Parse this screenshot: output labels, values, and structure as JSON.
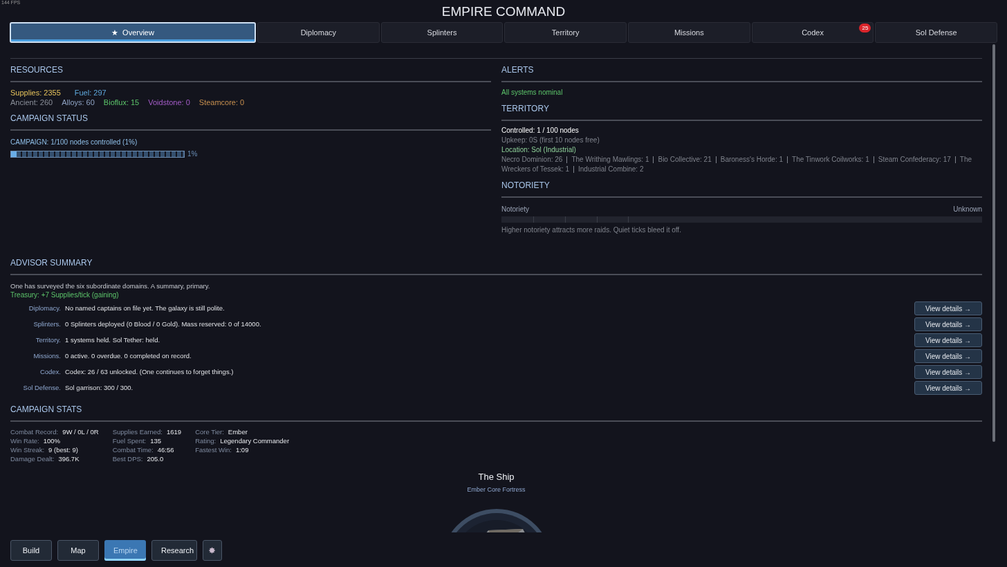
{
  "fps": "144 FPS",
  "title": "EMPIRE COMMAND",
  "tabs": [
    {
      "label": "Overview",
      "icon": "★",
      "selected": true
    },
    {
      "label": "Diplomacy",
      "selected": false
    },
    {
      "label": "Splinters",
      "selected": false
    },
    {
      "label": "Territory",
      "selected": false
    },
    {
      "label": "Missions",
      "selected": false
    },
    {
      "label": "Codex",
      "badge": "25",
      "selected": false
    },
    {
      "label": "Sol Defense",
      "selected": false
    }
  ],
  "resources": {
    "heading": "RESOURCES",
    "rows": [
      [
        {
          "text": "Supplies: 2355",
          "color": "#e6c35c"
        },
        {
          "text": "Fuel: 297",
          "color": "#5fa8dc"
        }
      ],
      [
        {
          "text": "Ancient: 260",
          "color": "#8a8f99"
        },
        {
          "text": "Alloys: 60",
          "color": "#8fa3c4"
        },
        {
          "text": "Bioflux: 15",
          "color": "#5cc46a"
        },
        {
          "text": "Voidstone: 0",
          "color": "#a45cc8"
        },
        {
          "text": "Steamcore: 0",
          "color": "#c8904f"
        }
      ]
    ]
  },
  "campaign_status": {
    "heading": "CAMPAIGN STATUS",
    "label": "CAMPAIGN: 1/100 nodes controlled (1%)",
    "level": 0.01,
    "reading": "1%"
  },
  "alerts": {
    "heading": "ALERTS",
    "message": "All systems nominal"
  },
  "territory": {
    "heading": "TERRITORY",
    "controlled": "Controlled: 1 / 100 nodes",
    "upkeep": "Upkeep: 0S (first 10 nodes free)",
    "location": "Location: Sol (Industrial)",
    "factions": [
      "Necro Dominion: 26",
      "The Writhing Mawlings: 1",
      "Bio Collective: 21",
      "Baroness's Horde: 1",
      "The Tinwork Coilworks: 1",
      "Steam Confederacy: 17",
      "The Wreckers of Tessek: 1",
      "Industrial Combine: 2"
    ]
  },
  "notoriety": {
    "heading": "NOTORIETY",
    "label": "Notoriety",
    "reading": "Unknown",
    "hint": "Higher notoriety attracts more raids. Quiet ticks bleed it off."
  },
  "advisor": {
    "heading": "ADVISOR SUMMARY",
    "intro": "One has surveyed the six subordinate domains. A summary, primary.",
    "treasury": "Treasury: +7 Supplies/tick (gaining)",
    "entries": [
      {
        "domain": "Diplomacy.",
        "summary": "No named captains on file yet. The galaxy is still polite.",
        "button": "View details →"
      },
      {
        "domain": "Splinters.",
        "summary": "0 Splinters deployed (0 Blood / 0 Gold). Mass reserved: 0 of 14000.",
        "button": "View details →"
      },
      {
        "domain": "Territory.",
        "summary": "1 systems held. Sol Tether: held.",
        "button": "View details →"
      },
      {
        "domain": "Missions.",
        "summary": "0 active. 0 overdue. 0 completed on record.",
        "button": "View details →"
      },
      {
        "domain": "Codex.",
        "summary": "Codex: 26 / 63 unlocked. (One continues to forget things.)",
        "button": "View details →"
      },
      {
        "domain": "Sol Defense.",
        "summary": "Sol garrison: 300 / 300.",
        "button": "View details →"
      }
    ]
  },
  "campaign_stats": {
    "heading": "CAMPAIGN STATS",
    "columns": [
      [
        {
          "label": "Combat Record:",
          "value": "9W / 0L / 0R"
        },
        {
          "label": "Win Rate:",
          "value": "100%"
        },
        {
          "label": "Win Streak:",
          "value": "9 (best: 9)"
        },
        {
          "label": "Damage Dealt:",
          "value": "396.7K"
        }
      ],
      [
        {
          "label": "Supplies Earned:",
          "value": "1619"
        },
        {
          "label": "Fuel Spent:",
          "value": "135"
        },
        {
          "label": "Combat Time:",
          "value": "46:56"
        },
        {
          "label": "Best DPS:",
          "value": "205.0"
        }
      ],
      [
        {
          "label": "Core Tier:",
          "value": "Ember"
        },
        {
          "label": "Rating:",
          "value": "Legendary Commander"
        },
        {
          "label": "Fastest Win:",
          "value": "1:09"
        }
      ]
    ]
  },
  "ship": {
    "title": "The Ship",
    "subtitle": "Ember Core Fortress"
  },
  "nav": [
    {
      "kind": "text",
      "label": "Build",
      "selected": false
    },
    {
      "kind": "text",
      "label": "Map",
      "selected": false
    },
    {
      "kind": "text",
      "label": "Empire",
      "selected": true
    },
    {
      "kind": "text",
      "label": "Research",
      "selected": false
    },
    {
      "kind": "settings",
      "selected": false
    }
  ]
}
